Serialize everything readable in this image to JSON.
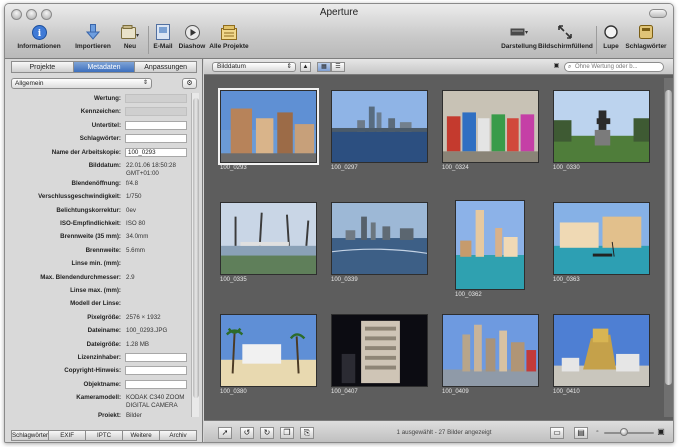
{
  "window": {
    "title": "Aperture"
  },
  "toolbar": {
    "info": "Informationen",
    "import": "Importieren",
    "new": "Neu",
    "email": "E-Mail",
    "slideshow": "Diashow",
    "all_projects": "Alle Projekte",
    "display": "Darstellung",
    "fullscreen": "Bildschirmfüllend",
    "loupe": "Lupe",
    "keywords": "Schlagwörter"
  },
  "inspector": {
    "tabs": [
      "Projekte",
      "Metadaten",
      "Anpassungen"
    ],
    "active_tab": 1,
    "preset": "Allgemein",
    "fields": [
      {
        "label": "Wertung:",
        "value": "",
        "kind": "empty"
      },
      {
        "label": "Kennzeichen:",
        "value": "",
        "kind": "empty"
      },
      {
        "label": "Untertitel:",
        "value": "",
        "kind": "field"
      },
      {
        "label": "Schlagwörter:",
        "value": "",
        "kind": "field"
      },
      {
        "label": "Name der Arbeitskopie:",
        "value": "100_0293",
        "kind": "field"
      },
      {
        "label": "Bilddatum:",
        "value": "22.01.06 18:50:28\nGMT+01:00",
        "kind": "text"
      },
      {
        "label": "Blendenöffnung:",
        "value": "f/4.8",
        "kind": "text"
      },
      {
        "label": "Verschlussgeschwindigkeit:",
        "value": "1/750",
        "kind": "text"
      },
      {
        "label": "Belichtungskorrektur:",
        "value": "0ev",
        "kind": "text"
      },
      {
        "label": "ISO-Empfindlichkeit:",
        "value": "ISO 80",
        "kind": "text"
      },
      {
        "label": "Brennweite (35 mm):",
        "value": "34.0mm",
        "kind": "text"
      },
      {
        "label": "Brennweite:",
        "value": "5.6mm",
        "kind": "text"
      },
      {
        "label": "Linse min. (mm):",
        "value": "",
        "kind": "text"
      },
      {
        "label": "Max. Blendendurchmesser:",
        "value": "2.9",
        "kind": "text"
      },
      {
        "label": "Linse max. (mm):",
        "value": "",
        "kind": "text"
      },
      {
        "label": "Modell der Linse:",
        "value": "",
        "kind": "text"
      },
      {
        "label": "Pixelgröße:",
        "value": "2576 × 1932",
        "kind": "text"
      },
      {
        "label": "Dateiname:",
        "value": "100_0293.JPG",
        "kind": "text"
      },
      {
        "label": "Dateigröße:",
        "value": "1.28 MB",
        "kind": "text"
      },
      {
        "label": "Lizenzinhaber:",
        "value": "",
        "kind": "field"
      },
      {
        "label": "Copyright-Hinweis:",
        "value": "",
        "kind": "field"
      },
      {
        "label": "Objektname:",
        "value": "",
        "kind": "field"
      },
      {
        "label": "Kameramodell:",
        "value": "KODAK C340 ZOOM\nDIGITAL CAMERA",
        "kind": "text"
      },
      {
        "label": "Projekt:",
        "value": "Bilder",
        "kind": "text"
      }
    ],
    "bottom_tabs": [
      "Schlagwörter",
      "EXIF",
      "IPTC",
      "Weitere",
      "Archiv"
    ]
  },
  "browser": {
    "sort": "Bilddatum",
    "search_placeholder": "Ohne Wertung oder b...",
    "status": "1 ausgewählt - 27 Bilder angezeigt",
    "zoom": 0.4,
    "images": [
      {
        "name": "100_0293",
        "scene": "buildings",
        "selected": true
      },
      {
        "name": "100_0297",
        "scene": "skyline"
      },
      {
        "name": "100_0324",
        "scene": "newsboxes"
      },
      {
        "name": "100_0330",
        "scene": "statue"
      },
      {
        "name": "100_0335",
        "scene": "park"
      },
      {
        "name": "100_0339",
        "scene": "river"
      },
      {
        "name": "100_0362",
        "scene": "canal-tall"
      },
      {
        "name": "100_0363",
        "scene": "canal"
      },
      {
        "name": "100_0380",
        "scene": "palms"
      },
      {
        "name": "100_0407",
        "scene": "night"
      },
      {
        "name": "100_0409",
        "scene": "nyny"
      },
      {
        "name": "100_0410",
        "scene": "sphinx"
      }
    ]
  }
}
